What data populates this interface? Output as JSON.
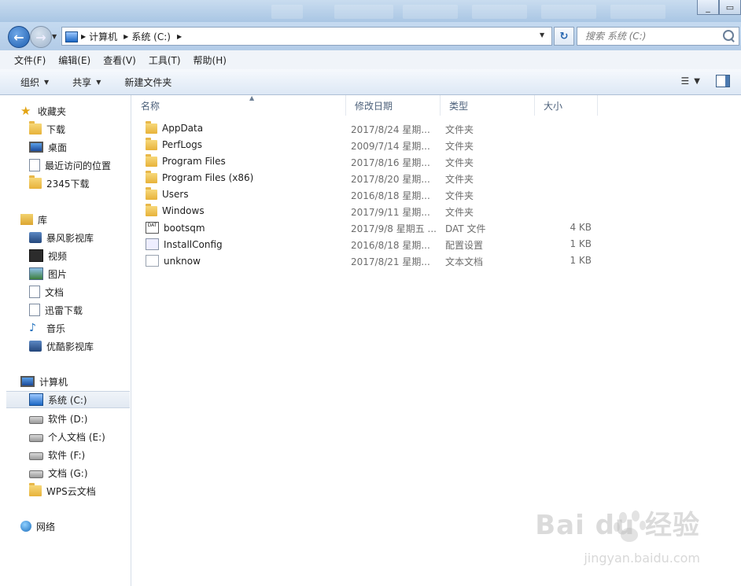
{
  "window": {
    "minimize_label": "_",
    "restore_label": "▭"
  },
  "address": {
    "crumbs": [
      "计算机",
      "系统 (C:)"
    ],
    "search_placeholder": "搜索 系统 (C:)"
  },
  "menu": [
    "文件(F)",
    "编辑(E)",
    "查看(V)",
    "工具(T)",
    "帮助(H)"
  ],
  "toolbar": {
    "organize": "组织",
    "share": "共享",
    "new_folder": "新建文件夹"
  },
  "nav": {
    "favorites": {
      "label": "收藏夹",
      "items": [
        "下载",
        "桌面",
        "最近访问的位置",
        "2345下载"
      ]
    },
    "libraries": {
      "label": "库",
      "items": [
        "暴风影视库",
        "视频",
        "图片",
        "文档",
        "迅雷下载",
        "音乐",
        "优酷影视库"
      ]
    },
    "computer": {
      "label": "计算机",
      "items": [
        "系统 (C:)",
        "软件 (D:)",
        "个人文档 (E:)",
        "软件 (F:)",
        "文档 (G:)",
        "WPS云文档"
      ],
      "selected": "系统 (C:)"
    },
    "network": {
      "label": "网络"
    }
  },
  "columns": {
    "name": "名称",
    "date": "修改日期",
    "type": "类型",
    "size": "大小"
  },
  "files": [
    {
      "name": "AppData",
      "date": "2017/8/24 星期...",
      "type": "文件夹",
      "size": "",
      "icon": "folder"
    },
    {
      "name": "PerfLogs",
      "date": "2009/7/14 星期...",
      "type": "文件夹",
      "size": "",
      "icon": "folder"
    },
    {
      "name": "Program Files",
      "date": "2017/8/16 星期...",
      "type": "文件夹",
      "size": "",
      "icon": "folder"
    },
    {
      "name": "Program Files (x86)",
      "date": "2017/8/20 星期...",
      "type": "文件夹",
      "size": "",
      "icon": "folder"
    },
    {
      "name": "Users",
      "date": "2016/8/18 星期...",
      "type": "文件夹",
      "size": "",
      "icon": "folder"
    },
    {
      "name": "Windows",
      "date": "2017/9/11 星期...",
      "type": "文件夹",
      "size": "",
      "icon": "folder"
    },
    {
      "name": "bootsqm",
      "date": "2017/9/8 星期五 ...",
      "type": "DAT 文件",
      "size": "4 KB",
      "icon": "dat"
    },
    {
      "name": "InstallConfig",
      "date": "2016/8/18 星期...",
      "type": "配置设置",
      "size": "1 KB",
      "icon": "config"
    },
    {
      "name": "unknow",
      "date": "2017/8/21 星期...",
      "type": "文本文档",
      "size": "1 KB",
      "icon": "text"
    }
  ],
  "watermark": {
    "brand": "Bai du 经验",
    "url": "jingyan.baidu.com"
  }
}
